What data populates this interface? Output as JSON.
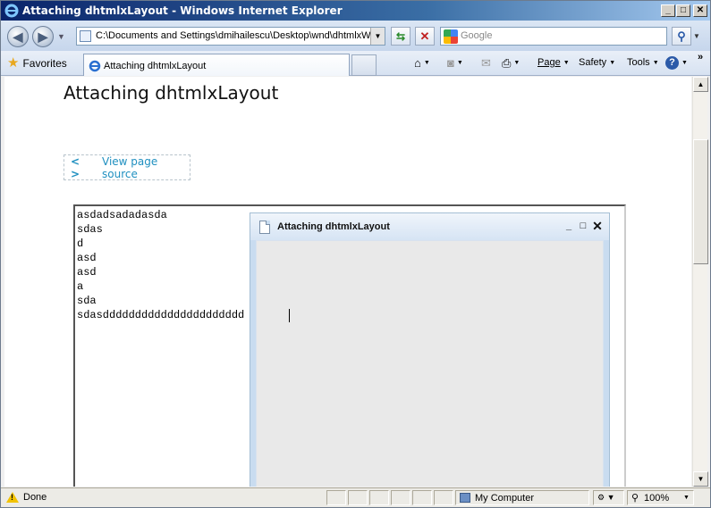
{
  "window": {
    "title": "Attaching dhtmlxLayout - Windows Internet Explorer",
    "min_glyph": "_",
    "max_glyph": "□",
    "close_glyph": "✕"
  },
  "address": {
    "url": "C:\\Documents and Settings\\dmihailescu\\Desktop\\wnd\\dhtmlxWi",
    "search_placeholder": "Google"
  },
  "favorites": {
    "label": "Favorites"
  },
  "tab": {
    "label": "Attaching dhtmlxLayout"
  },
  "commands": {
    "page": "Page",
    "safety": "Safety",
    "tools": "Tools"
  },
  "page": {
    "title": "Attaching dhtmlxLayout",
    "view_source_icon": "< >",
    "view_source": "View page source",
    "textarea_lines": "asdadsadadasda\nsdas\nd\nasd\nasd\na\nsda\nsdasdddddddddddddddddddddd"
  },
  "dhx_window": {
    "title": "Attaching dhtmlxLayout"
  },
  "status": {
    "text": "Done",
    "zone": "My Computer",
    "zoom": "100%"
  },
  "icons": {
    "ie": "ie-logo-icon",
    "back": "back-arrow-icon",
    "forward": "forward-arrow-icon",
    "home": "home-icon",
    "feeds": "feeds-icon",
    "mail": "mail-icon",
    "print": "print-icon",
    "help": "help-icon"
  }
}
